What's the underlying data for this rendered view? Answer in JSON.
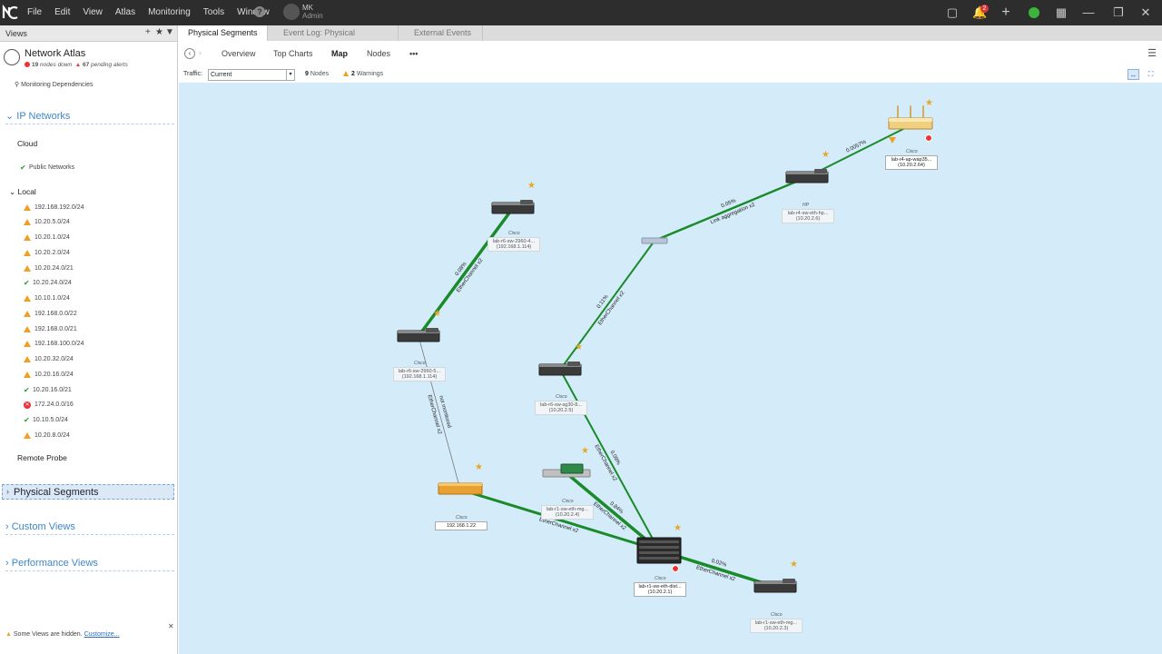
{
  "titlebar": {
    "menu": [
      "File",
      "Edit",
      "View",
      "Atlas",
      "Monitoring",
      "Tools",
      "Window"
    ],
    "user_name": "MK",
    "user_role": "Admin",
    "notification_count": "2"
  },
  "left_panel": {
    "header": "Views",
    "atlas_title": "Network Atlas",
    "nodes_down": "19",
    "nodes_down_label": "nodes down",
    "pending_alerts": "67",
    "pending_alerts_label": "pending alerts",
    "monitoring_dependencies": "Monitoring Dependencies",
    "ip_networks": "IP Networks",
    "cloud": "Cloud",
    "public_networks": "Public Networks",
    "local": "Local",
    "networks": [
      {
        "name": "192.168.192.0/24",
        "status": "warning"
      },
      {
        "name": "10.20.5.0/24",
        "status": "warning"
      },
      {
        "name": "10.20.1.0/24",
        "status": "warning"
      },
      {
        "name": "10.20.2.0/24",
        "status": "warning"
      },
      {
        "name": "10.20.24.0/21",
        "status": "warning"
      },
      {
        "name": "10.20.24.0/24",
        "status": "ok"
      },
      {
        "name": "10.10.1.0/24",
        "status": "warning"
      },
      {
        "name": "192.168.0.0/22",
        "status": "warning"
      },
      {
        "name": "192.168.0.0/21",
        "status": "warning"
      },
      {
        "name": "192.168.100.0/24",
        "status": "warning"
      },
      {
        "name": "10.20.32.0/24",
        "status": "warning"
      },
      {
        "name": "10.20.16.0/24",
        "status": "warning"
      },
      {
        "name": "10.20.16.0/21",
        "status": "ok"
      },
      {
        "name": "172.24.0.0/16",
        "status": "error"
      },
      {
        "name": "10.10.5.0/24",
        "status": "ok"
      },
      {
        "name": "10.20.8.0/24",
        "status": "warning"
      }
    ],
    "remote_probe": "Remote Probe",
    "physical_segments": "Physical Segments",
    "custom_views": "Custom Views",
    "performance_views": "Performance Views",
    "hidden_note": "Some Views are hidden.",
    "customize": "Customize..."
  },
  "tabs": [
    "Physical Segments",
    "Event Log: Physical Segments",
    "External Events"
  ],
  "toolbar": {
    "overview": "Overview",
    "top_charts": "Top Charts",
    "map": "Map",
    "nodes": "Nodes",
    "more": "•••"
  },
  "filter": {
    "traffic_label": "Traffic:",
    "traffic_value": "Current",
    "nodes_count": "9",
    "nodes_label": "Nodes",
    "warnings_count": "2",
    "warnings_label": "Warnings"
  },
  "map": {
    "nodes": [
      {
        "id": "n1",
        "vendor": "Cisco",
        "name": "lab-r6-sw-2960-4...",
        "ip": "(192.168.1.114)"
      },
      {
        "id": "n2",
        "vendor": "Cisco",
        "name": "lab-r6-sw-2960-5...",
        "ip": "(192.168.1.114)"
      },
      {
        "id": "n3",
        "vendor": "Cisco",
        "name": "lab-r6-sw-sg30-8...",
        "ip": "(10.20.2.5)"
      },
      {
        "id": "n4",
        "vendor": "Cisco",
        "name": "192.168.1.22",
        "ip": ""
      },
      {
        "id": "n5",
        "vendor": "Cisco",
        "name": "lab-r1-sw-eth-mg...",
        "ip": "(10.20.2.4)"
      },
      {
        "id": "n6",
        "vendor": "Cisco",
        "name": "lab-r1-sw-eth-dist...",
        "ip": "(10.20.2.1)"
      },
      {
        "id": "n7",
        "vendor": "Cisco",
        "name": "lab-r1-sw-eth-mg...",
        "ip": "(10.20.2.3)"
      },
      {
        "id": "n8",
        "vendor": "HP",
        "name": "lab-r4-sw-eth-hp...",
        "ip": "(10.20.2.6)"
      },
      {
        "id": "n9",
        "vendor": "Cisco",
        "name": "lab-r4-ap-wap35...",
        "ip": "(10.20.2.64)"
      }
    ],
    "links": [
      {
        "label_top": "0.08%",
        "label_bottom": "EtherChannel x2"
      },
      {
        "label_top": "not monitored",
        "label_bottom": "EtherChannel x2"
      },
      {
        "label_top": "0.11%",
        "label_bottom": "EtherChannel x2"
      },
      {
        "label_top": "0.05%",
        "label_bottom": "Link aggregation x2"
      },
      {
        "label_top": "0.0057%",
        "label_bottom": ""
      },
      {
        "label_top": "0.09%",
        "label_bottom": "EtherChannel x2"
      },
      {
        "label_top": "0.84%",
        "label_bottom": "EtherChannel x2"
      },
      {
        "label_top": "",
        "label_bottom": "EtherChannel x2"
      },
      {
        "label_top": "0.02%",
        "label_bottom": "EtherChannel x2"
      }
    ]
  },
  "colors": {
    "link_green": "#1a8a2a",
    "map_bg": "#d4ecf9",
    "accent_blue": "#3d87c9",
    "warning": "#f0a020",
    "error": "#e33333"
  }
}
